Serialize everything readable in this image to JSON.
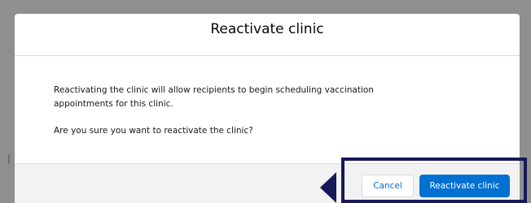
{
  "modal": {
    "title": "Reactivate clinic",
    "body": {
      "paragraph1": "Reactivating the clinic will allow recipients to begin scheduling vaccination appointments for this clinic.",
      "paragraph2": "Are you sure you want to reactivate the clinic?"
    },
    "footer": {
      "cancel_label": "Cancel",
      "confirm_label": "Reactivate clinic"
    }
  },
  "colors": {
    "backdrop": "#8f8f8f",
    "primary": "#0070d2",
    "highlight": "#16185a",
    "footer_bg": "#f3f2f2"
  },
  "annotation": {
    "highlight_icon": "left-pointing-triangle-icon"
  }
}
